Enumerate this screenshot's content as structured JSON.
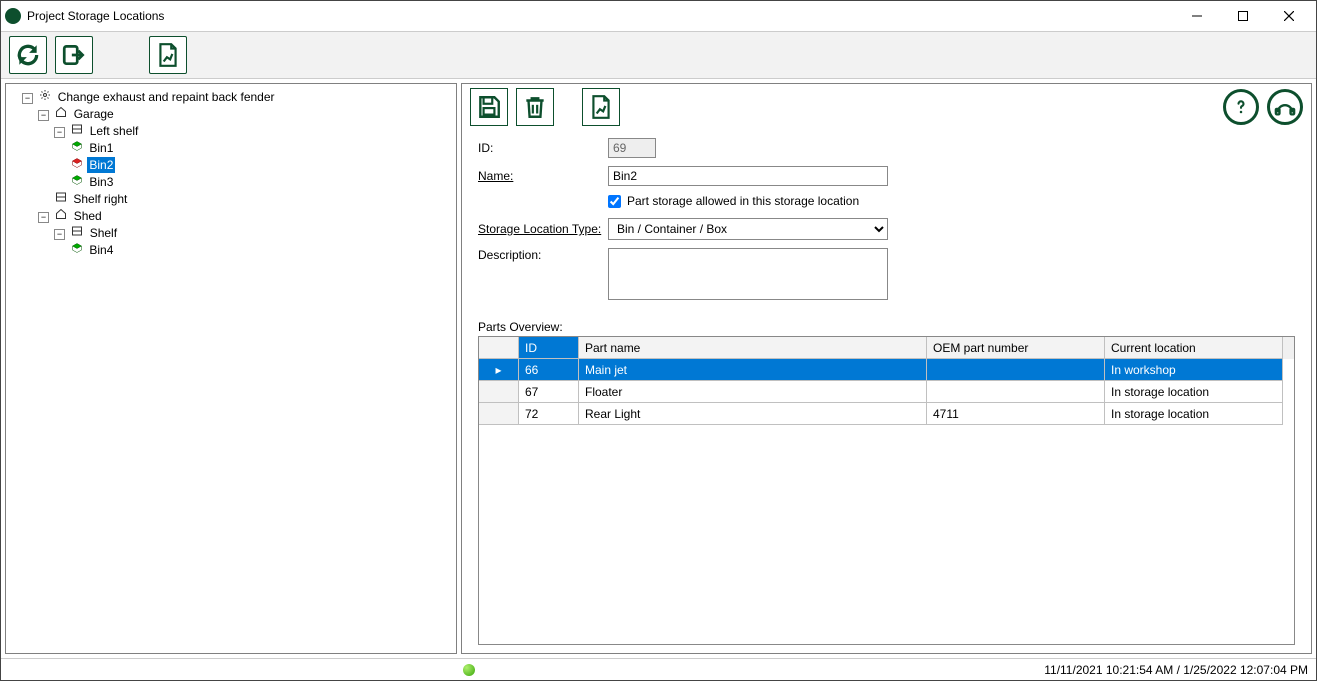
{
  "window": {
    "title": "Project Storage Locations"
  },
  "tree": {
    "root": {
      "label": "Change exhaust and repaint back fender",
      "children": [
        {
          "label": "Garage",
          "children": [
            {
              "label": "Left shelf",
              "children": [
                {
                  "label": "Bin1"
                },
                {
                  "label": "Bin2",
                  "selected": true
                },
                {
                  "label": "Bin3"
                }
              ]
            },
            {
              "label": "Shelf right"
            }
          ]
        },
        {
          "label": "Shed",
          "children": [
            {
              "label": "Shelf",
              "children": [
                {
                  "label": "Bin4"
                }
              ]
            }
          ]
        }
      ]
    }
  },
  "form": {
    "id_label": "ID:",
    "id_value": "69",
    "name_label": "Name:",
    "name_value": "Bin2",
    "allow_label": "Part storage allowed in this storage location",
    "allow_checked": true,
    "type_label": "Storage Location Type:",
    "type_value": "Bin / Container / Box",
    "desc_label": "Description:",
    "desc_value": ""
  },
  "parts": {
    "label": "Parts Overview:",
    "columns": {
      "id": "ID",
      "name": "Part name",
      "oem": "OEM part number",
      "loc": "Current location"
    },
    "rows": [
      {
        "id": "66",
        "name": "Main jet",
        "oem": "",
        "loc": "In workshop",
        "selected": true
      },
      {
        "id": "67",
        "name": "Floater",
        "oem": "",
        "loc": "In storage location",
        "selected": false
      },
      {
        "id": "72",
        "name": "Rear Light",
        "oem": "4711",
        "loc": "In storage location",
        "selected": false
      }
    ]
  },
  "status": {
    "timestamps": "11/11/2021 10:21:54 AM / 1/25/2022 12:07:04 PM"
  }
}
